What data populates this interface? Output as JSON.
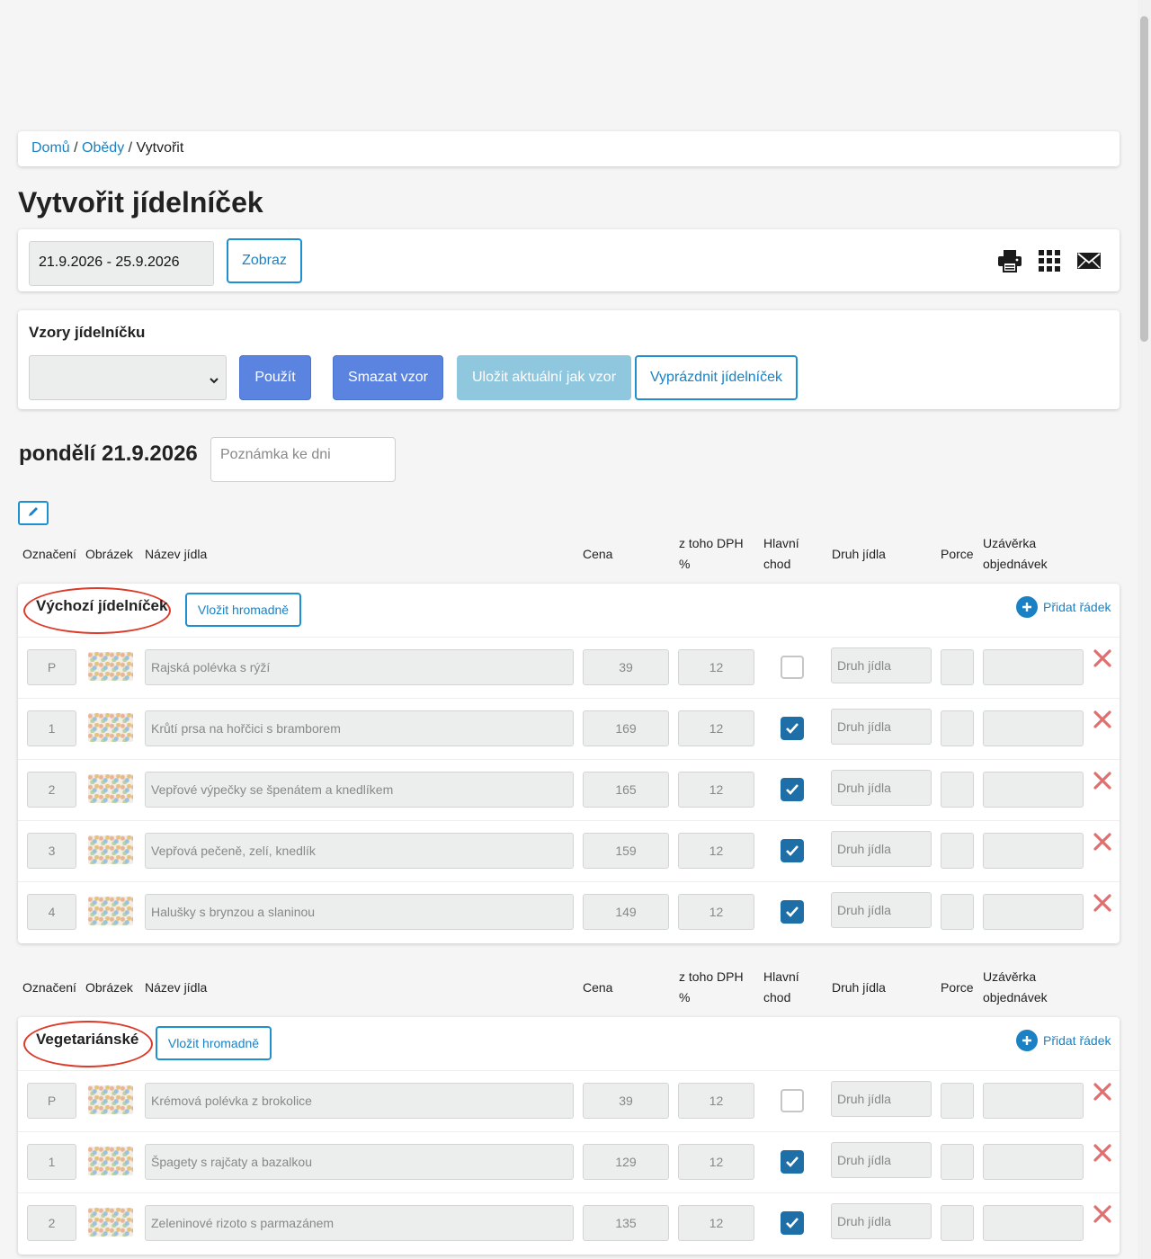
{
  "breadcrumb": {
    "home": "Domů",
    "sep": "/",
    "lunches": "Obědy",
    "current": "Vytvořit"
  },
  "page_title": "Vytvořit jídelníček",
  "date_range": "21.9.2026 - 25.9.2026",
  "show_button": "Zobraz",
  "toolbar_icons": [
    "printer-icon",
    "grid-icon",
    "envelope-icon"
  ],
  "templates": {
    "title": "Vzory jídelníčku",
    "selected": "",
    "use_button": "Použít",
    "delete_button": "Smazat vzor",
    "save_button": "Uložit aktuální jak vzor",
    "empty_button": "Vyprázdnit jídelníček"
  },
  "day": {
    "title": "pondělí 21.9.2026",
    "note_placeholder": "Poznámka ke dni"
  },
  "columns": {
    "label": "Označení",
    "image": "Obrázek",
    "name": "Název jídla",
    "price": "Cena",
    "vat_1": "z toho DPH",
    "vat_2": "%",
    "main_1": "Hlavní",
    "main_2": "chod",
    "type": "Druh jídla",
    "portion": "Porce",
    "deadline_1": "Uzávěrka",
    "deadline_2": "objednávek"
  },
  "field_placeholder_type": "Druh jídla",
  "bulk_button": "Vložit hromadně",
  "add_row": "Přidat řádek",
  "colors": {
    "accent": "#1a82c4",
    "primary": "#5b84e0",
    "danger": "#dc3b2a",
    "checkbox": "#1e6fa8"
  },
  "sections": [
    {
      "name": "Výchozí jídelníček",
      "rows": [
        {
          "label": "P",
          "name": "Rajská polévka s rýží",
          "price": "39",
          "vat": "12",
          "main": false
        },
        {
          "label": "1",
          "name": "Krůtí prsa na hořčici s bramborem",
          "price": "169",
          "vat": "12",
          "main": true
        },
        {
          "label": "2",
          "name": "Vepřové výpečky se špenátem a knedlíkem",
          "price": "165",
          "vat": "12",
          "main": true
        },
        {
          "label": "3",
          "name": "Vepřová pečeně, zelí, knedlík",
          "price": "159",
          "vat": "12",
          "main": true
        },
        {
          "label": "4",
          "name": "Halušky s brynzou a slaninou",
          "price": "149",
          "vat": "12",
          "main": true
        }
      ]
    },
    {
      "name": "Vegetariánské",
      "rows": [
        {
          "label": "P",
          "name": "Krémová polévka z brokolice",
          "price": "39",
          "vat": "12",
          "main": false
        },
        {
          "label": "1",
          "name": "Špagety s rajčaty a bazalkou",
          "price": "129",
          "vat": "12",
          "main": true
        },
        {
          "label": "2",
          "name": "Zeleninové rizoto s parmazánem",
          "price": "135",
          "vat": "12",
          "main": true
        }
      ]
    }
  ]
}
